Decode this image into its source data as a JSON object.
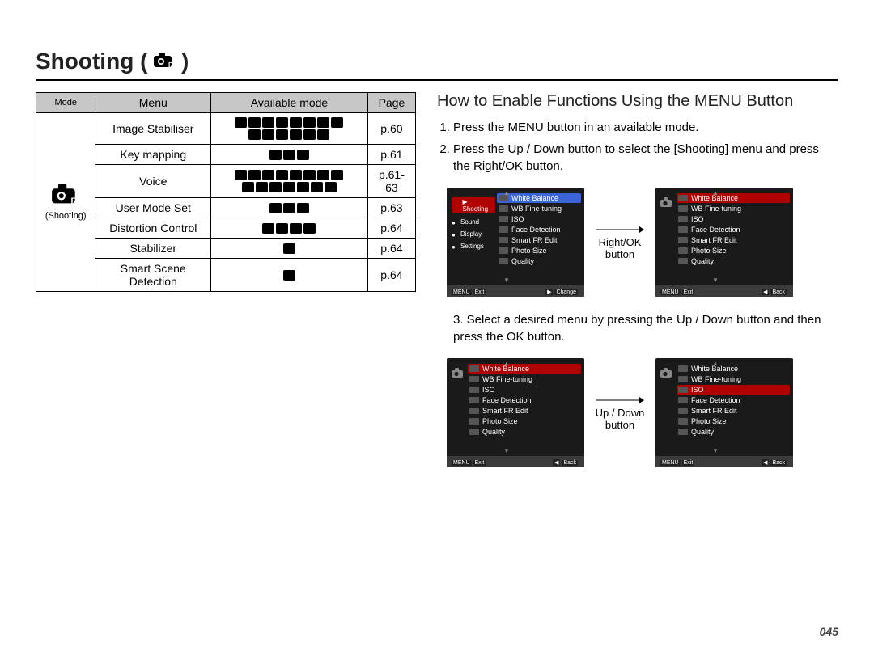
{
  "page_number": "045",
  "title": "Shooting",
  "title_icon": "camera-fn-icon",
  "table": {
    "headers": {
      "mode": "Mode",
      "menu": "Menu",
      "available": "Available mode",
      "page": "Page"
    },
    "mode_label": "(Shooting)",
    "rows": [
      {
        "menu": "Image Stabiliser",
        "page": "p.60",
        "icon_count_row1": 8,
        "icon_count_row2": 6
      },
      {
        "menu": "Key mapping",
        "page": "p.61",
        "icon_count_row1": 3,
        "icon_count_row2": 0
      },
      {
        "menu": "Voice",
        "page": "p.61-63",
        "icon_count_row1": 8,
        "icon_count_row2": 7
      },
      {
        "menu": "User Mode Set",
        "page": "p.63",
        "icon_count_row1": 3,
        "icon_count_row2": 0
      },
      {
        "menu": "Distortion Control",
        "page": "p.64",
        "icon_count_row1": 4,
        "icon_count_row2": 0
      },
      {
        "menu": "Stabilizer",
        "page": "p.64",
        "icon_count_row1": 1,
        "icon_count_row2": 0
      },
      {
        "menu": "Smart Scene Detection",
        "page": "p.64",
        "icon_count_row1": 1,
        "icon_count_row2": 0
      }
    ]
  },
  "subhead": "How to Enable Functions Using the MENU Button",
  "steps": [
    "Press the MENU button in an available mode.",
    "Press the Up / Down button to select the [Shooting] menu and press the Right/OK button."
  ],
  "step3": "3. Select a desired menu by pressing the Up / Down button and then press the OK button.",
  "arrows": {
    "rightok": "Right/OK button",
    "updown": "Up / Down button"
  },
  "screen_side_tabs": [
    "Shooting",
    "Sound",
    "Display",
    "Settings"
  ],
  "screen_list": [
    "White Balance",
    "WB Fine-tuning",
    "ISO",
    "Face Detection",
    "Smart FR Edit",
    "Photo Size",
    "Quality"
  ],
  "screen_footer": {
    "exit_btn": "MENU",
    "exit": "Exit",
    "change_btn": "▶",
    "change": "Change",
    "back_btn": "◀",
    "back": "Back"
  }
}
